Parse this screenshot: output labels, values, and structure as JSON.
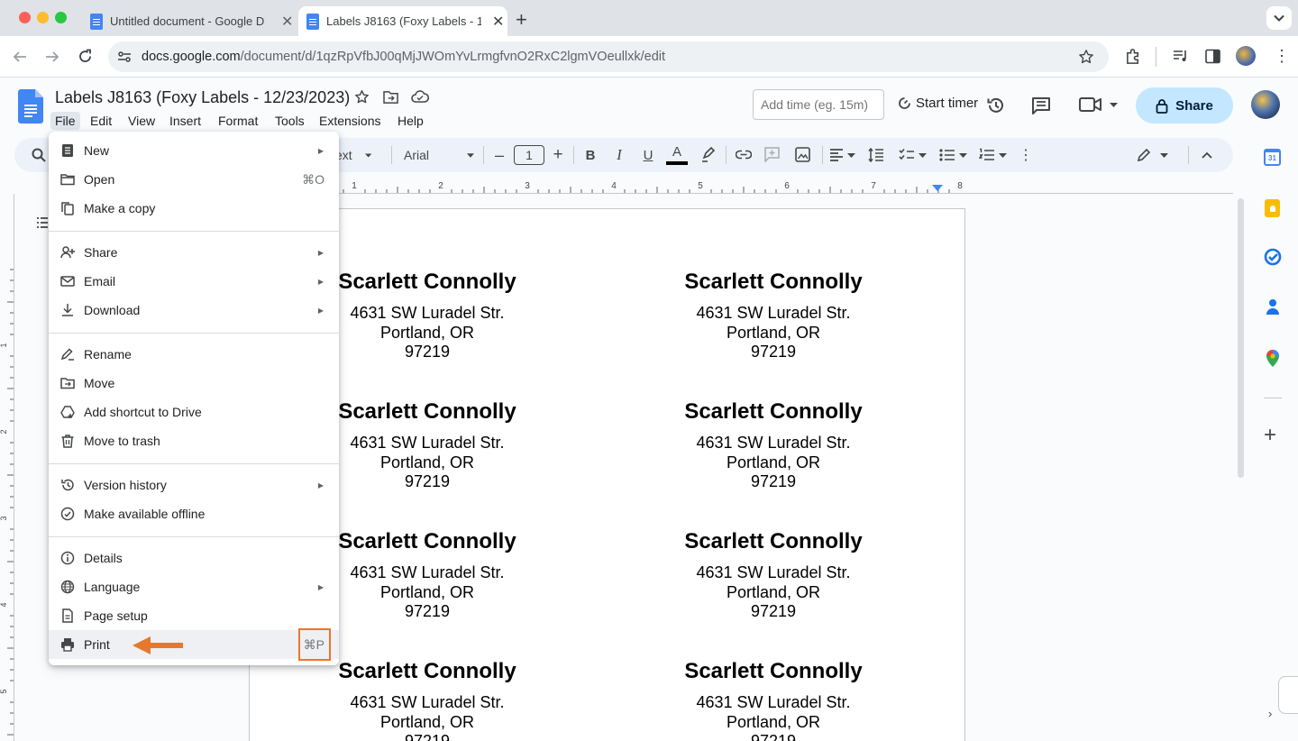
{
  "browser": {
    "tabs": [
      {
        "title": "Untitled document - Google D",
        "active": false
      },
      {
        "title": "Labels J8163 (Foxy Labels - 1",
        "active": true
      }
    ],
    "url_host": "docs.google.com",
    "url_path": "/document/d/1qzRpVfbJ00qMjJWOmYvLrmgfvnO2RxC2lgmVOeullxk/edit"
  },
  "doc": {
    "title": "Labels J8163 (Foxy Labels - 12/23/2023)",
    "menus": [
      "File",
      "Edit",
      "View",
      "Insert",
      "Format",
      "Tools",
      "Extensions",
      "Help"
    ],
    "time_placeholder": "Add time (eg. 15m)",
    "start_timer": "Start timer",
    "share": "Share"
  },
  "toolbar": {
    "style_fragment": "ext",
    "font": "Arial",
    "font_size": "1"
  },
  "ruler": {
    "marks": [
      "1",
      "2",
      "3",
      "4",
      "5",
      "6",
      "7",
      "8"
    ]
  },
  "vruler": {
    "marks": [
      "1",
      "2",
      "3",
      "4",
      "5"
    ]
  },
  "file_menu": {
    "items": [
      {
        "label": "New",
        "icon": "new-doc-icon",
        "submenu": true,
        "shortcut": ""
      },
      {
        "label": "Open",
        "icon": "folder-open-icon",
        "submenu": false,
        "shortcut": "⌘O"
      },
      {
        "label": "Make a copy",
        "icon": "copy-icon",
        "submenu": false,
        "shortcut": ""
      },
      {
        "label": "Share",
        "icon": "share-person-icon",
        "submenu": true,
        "shortcut": ""
      },
      {
        "label": "Email",
        "icon": "mail-icon",
        "submenu": true,
        "shortcut": ""
      },
      {
        "label": "Download",
        "icon": "download-icon",
        "submenu": true,
        "shortcut": ""
      },
      {
        "label": "Rename",
        "icon": "rename-icon",
        "submenu": false,
        "shortcut": ""
      },
      {
        "label": "Move",
        "icon": "move-folder-icon",
        "submenu": false,
        "shortcut": ""
      },
      {
        "label": "Add shortcut to Drive",
        "icon": "drive-shortcut-icon",
        "submenu": false,
        "shortcut": ""
      },
      {
        "label": "Move to trash",
        "icon": "trash-icon",
        "submenu": false,
        "shortcut": ""
      },
      {
        "label": "Version history",
        "icon": "history-icon",
        "submenu": true,
        "shortcut": ""
      },
      {
        "label": "Make available offline",
        "icon": "offline-check-icon",
        "submenu": false,
        "shortcut": ""
      },
      {
        "label": "Details",
        "icon": "info-icon",
        "submenu": false,
        "shortcut": ""
      },
      {
        "label": "Language",
        "icon": "globe-icon",
        "submenu": true,
        "shortcut": ""
      },
      {
        "label": "Page setup",
        "icon": "page-setup-icon",
        "submenu": false,
        "shortcut": ""
      },
      {
        "label": "Print",
        "icon": "printer-icon",
        "submenu": false,
        "shortcut": "⌘P",
        "highlighted": true
      }
    ]
  },
  "labels": {
    "name": "Scarlett Connolly",
    "line1": "4631 SW Luradel Str.",
    "line2": "Portland, OR",
    "line3": "97219"
  },
  "colors": {
    "accent": "#0b57d0",
    "share_bg": "#c2e7ff",
    "annotation": "#e8772e",
    "docs_blue": "#4285f4"
  }
}
